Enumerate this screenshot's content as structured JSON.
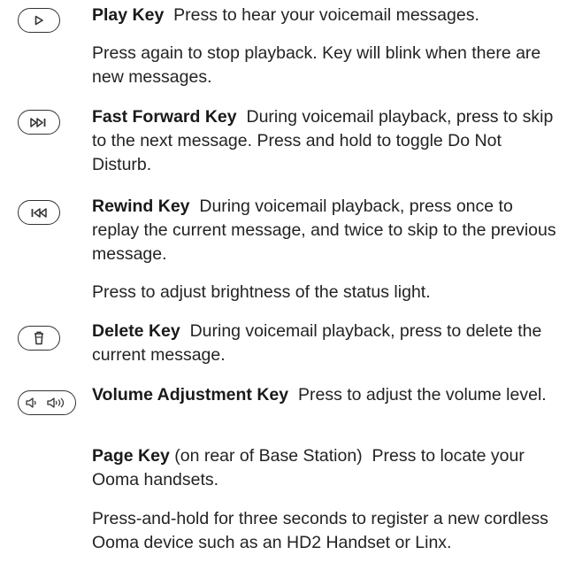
{
  "entries": [
    {
      "icon": "play-icon",
      "title": "Play Key",
      "desc": "Press to hear your voicemail messages."
    },
    {
      "para": "Press again to stop playback. Key will blink when there are new messages."
    },
    {
      "icon": "fast-forward-icon",
      "title": "Fast Forward Key",
      "desc": "During voicemail playback, press to skip to the next message. Press and hold to toggle Do Not Disturb."
    },
    {
      "icon": "rewind-icon",
      "title": "Rewind Key",
      "desc": "During voicemail playback, press once to replay the current message, and twice to skip to the previous message."
    },
    {
      "para": "Press to adjust brightness of the status light."
    },
    {
      "icon": "trash-icon",
      "title": "Delete Key",
      "desc": "During voicemail playback, press to delete the current message."
    },
    {
      "icon": "volume-icon",
      "title": "Volume Adjustment Key",
      "desc": "Press to adjust the volume level."
    },
    {
      "title": "Page Key",
      "suffix": "(on rear of Base Station)",
      "desc": "Press to locate your Ooma handsets."
    },
    {
      "para": "Press-and-hold for three seconds to register a new cordless Ooma device such as an HD2 Handset or Linx."
    }
  ]
}
